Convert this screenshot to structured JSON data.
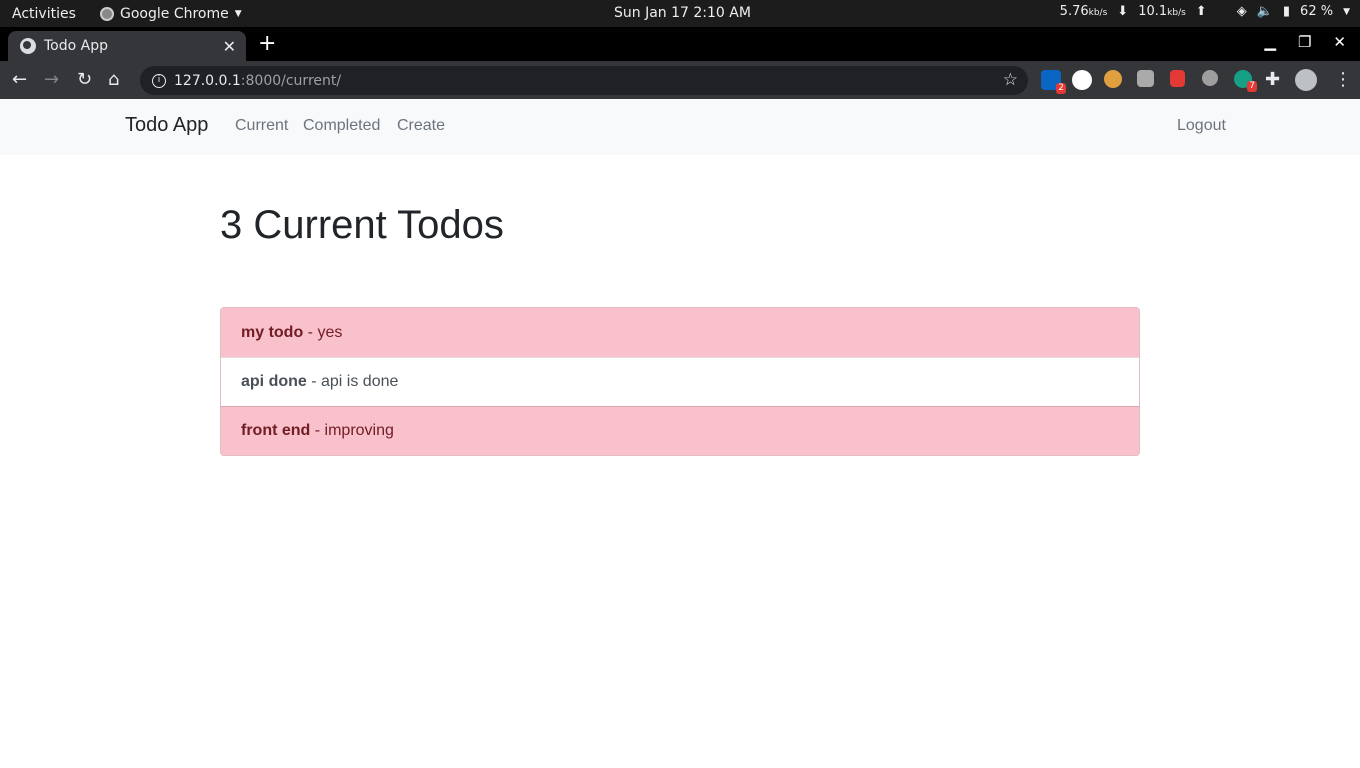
{
  "os_topbar": {
    "activities": "Activities",
    "app_name": "Google Chrome",
    "clock": "Sun Jan 17   2:10 AM",
    "down_speed": "5.76",
    "down_unit": "kb/s",
    "up_speed": "10.1",
    "up_unit": "kb/s",
    "battery": "62 %"
  },
  "browser": {
    "tab_title": "Todo App",
    "url_host": "127.0.0.1",
    "url_path": ":8000/current/",
    "extension_badges": [
      "2",
      "7"
    ]
  },
  "navbar": {
    "brand": "Todo App",
    "links": [
      "Current",
      "Completed",
      "Create"
    ],
    "logout": "Logout"
  },
  "main": {
    "heading": "3 Current Todos",
    "todos": [
      {
        "title": "my todo",
        "desc": " - yes",
        "important": true
      },
      {
        "title": "api done",
        "desc": " - api is done",
        "important": false
      },
      {
        "title": "front end",
        "desc": " - improving",
        "important": true
      }
    ]
  },
  "colors": {
    "important_bg": "#f8c1cb",
    "important_text": "#721c24",
    "navbar_bg": "#f8f9fa"
  }
}
